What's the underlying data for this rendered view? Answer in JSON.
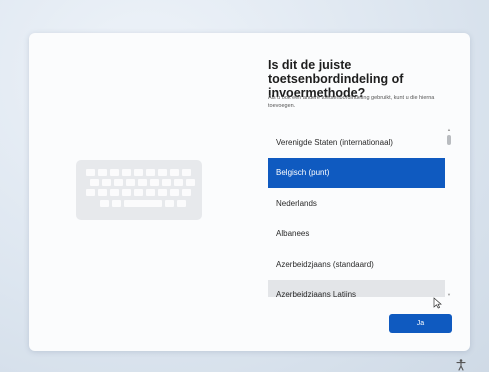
{
  "title": "Is dit de juiste toetsenbordindeling of invoermethode?",
  "subtitle": "Als u ook een andere toetsenbordindeling gebruikt, kunt u die hierna toevoegen.",
  "layouts": [
    {
      "label": "Verenigde Staten (internationaal)",
      "state": "normal"
    },
    {
      "label": "Belgisch (punt)",
      "state": "selected"
    },
    {
      "label": "Nederlands",
      "state": "normal"
    },
    {
      "label": "Albanees",
      "state": "normal"
    },
    {
      "label": "Azerbeidzjaans (standaard)",
      "state": "normal"
    },
    {
      "label": "Azerbeidzjaans Latijns",
      "state": "hover"
    }
  ],
  "selected_layout": "Belgisch (punt)",
  "confirm_label": "Ja",
  "icons": {
    "keyboard": "keyboard-icon",
    "accessibility": "accessibility-icon",
    "cursor": "mouse-pointer-icon"
  },
  "colors": {
    "accent": "#0f5ac0",
    "hover": "#e3e5e8"
  }
}
